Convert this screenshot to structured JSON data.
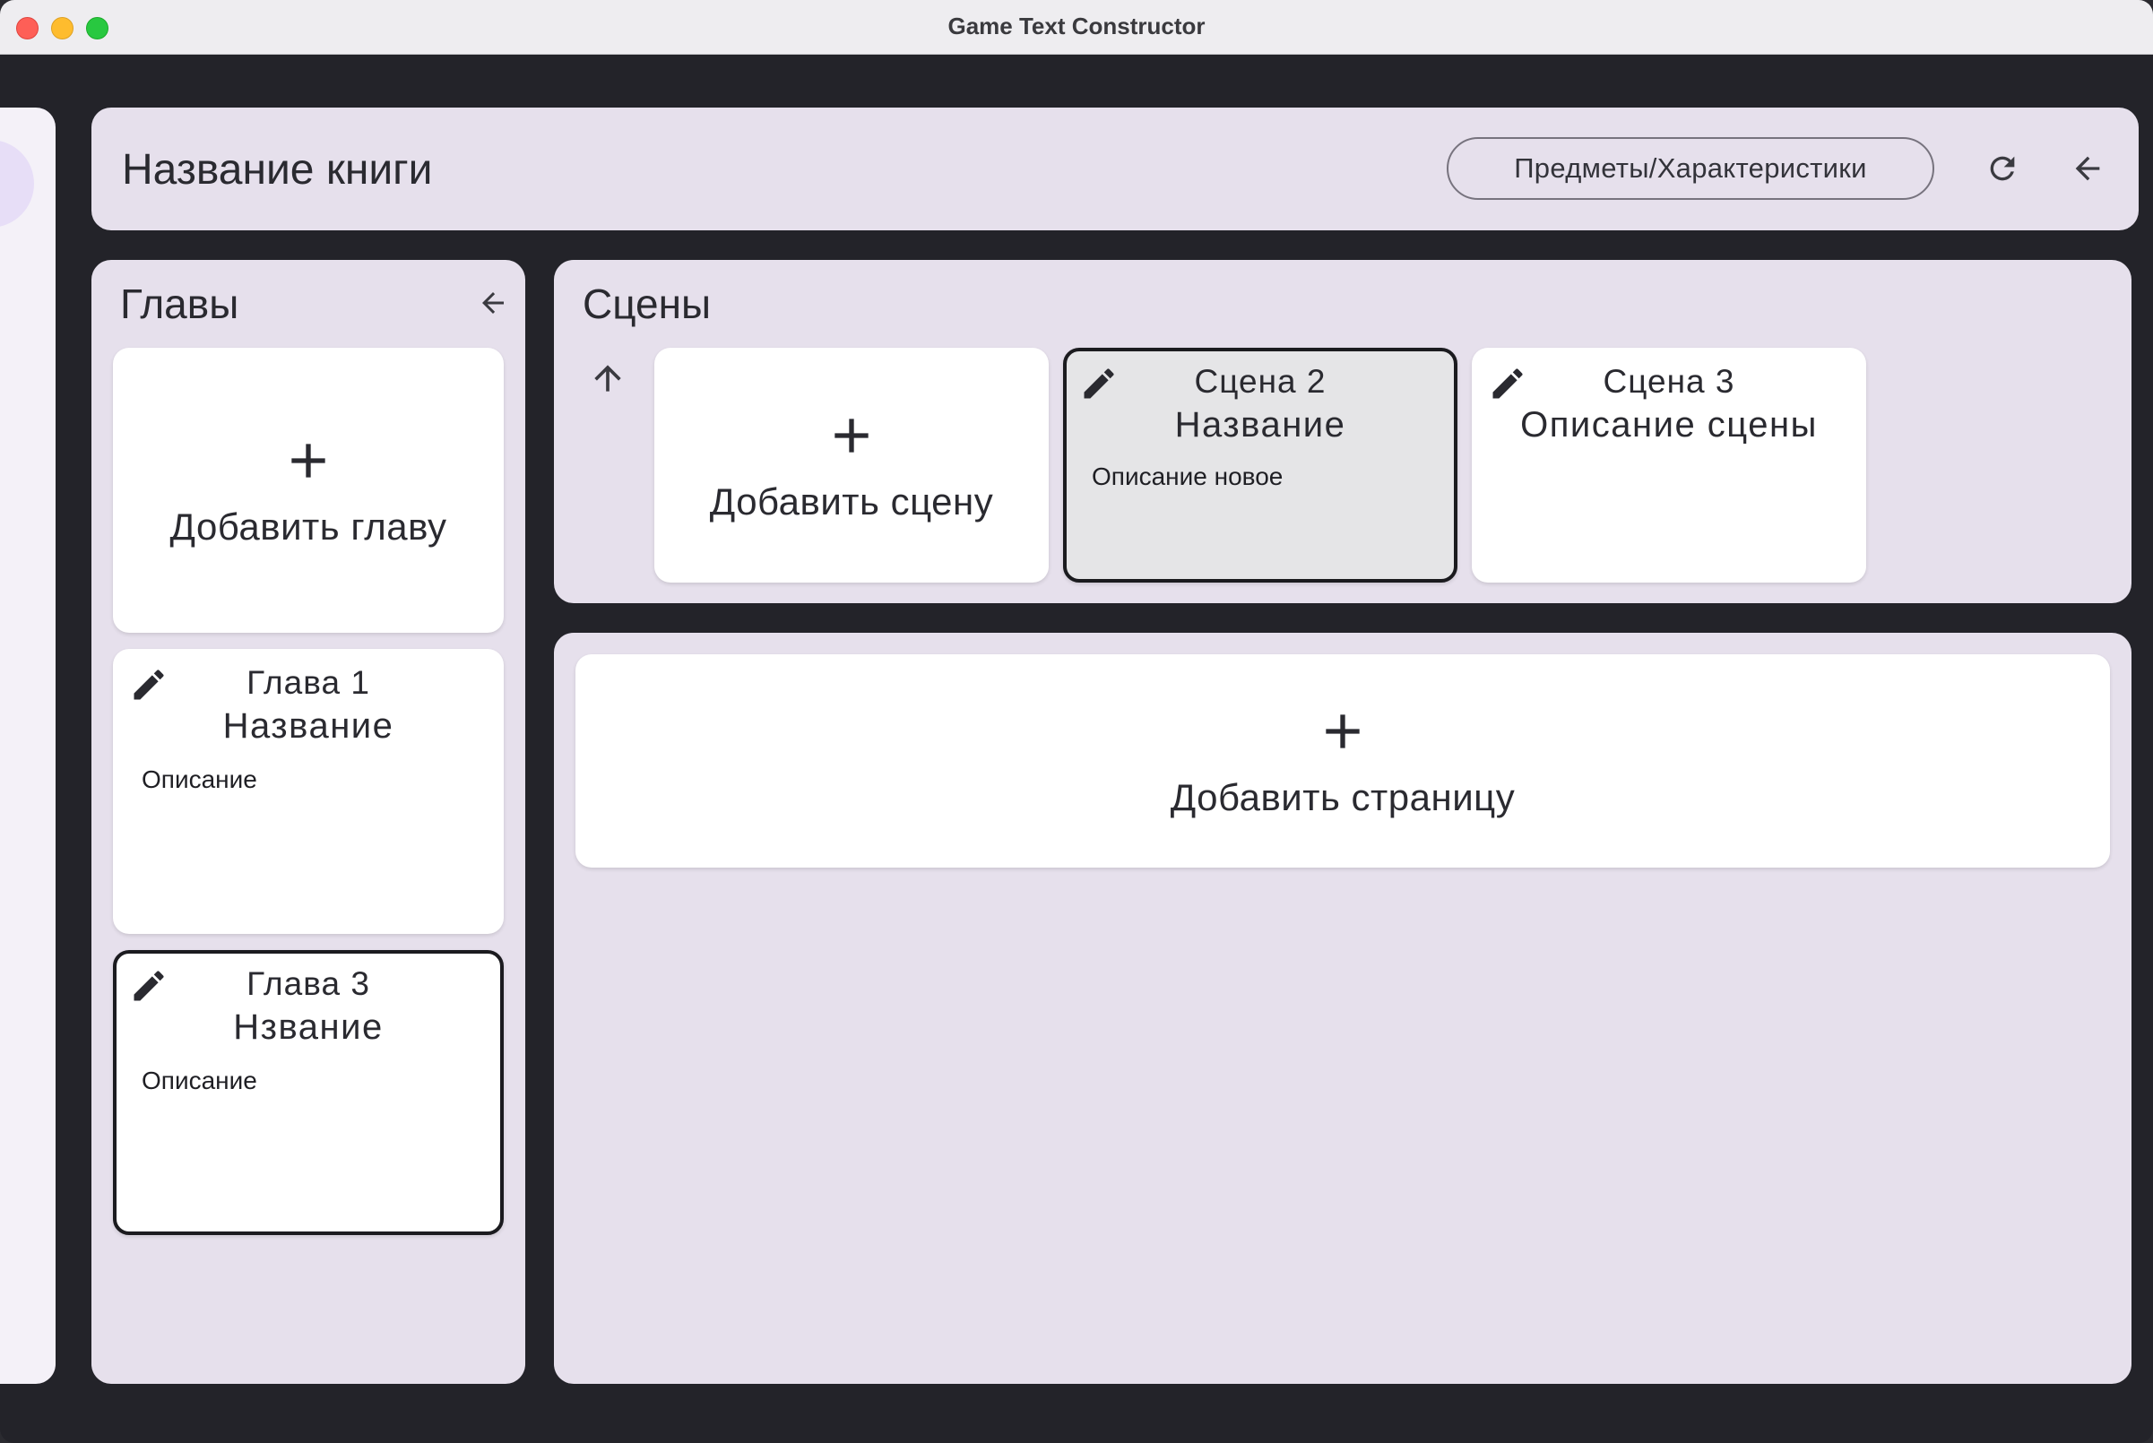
{
  "window": {
    "title": "Game Text Constructor"
  },
  "header": {
    "book_title": "Название книги",
    "items_button": "Предметы/Характеристики",
    "refresh_icon": "refresh-icon",
    "back_icon": "arrow-back-icon"
  },
  "chapters": {
    "title": "Главы",
    "collapse_icon": "arrow-back-icon",
    "add_label": "Добавить главу",
    "items": [
      {
        "number": "Глава 1",
        "name": "Название",
        "description": "Описание",
        "selected": false
      },
      {
        "number": "Глава 3",
        "name": "Нзвание",
        "description": "Описание",
        "selected": true
      }
    ]
  },
  "scenes": {
    "title": "Сцены",
    "up_icon": "arrow-up-icon",
    "add_label": "Добавить сцену",
    "items": [
      {
        "number": "Сцена 2",
        "name": "Название",
        "description": "Описание новое",
        "selected": true
      },
      {
        "number": "Сцена 3",
        "name": "Описание сцены",
        "description": "",
        "selected": false
      }
    ]
  },
  "pages": {
    "add_label": "Добавить страницу"
  },
  "colors": {
    "background": "#232329",
    "panel": "#e6e0ec",
    "card": "#ffffff",
    "selected_scene": "#e5e5e7",
    "text": "#2a2a30"
  }
}
